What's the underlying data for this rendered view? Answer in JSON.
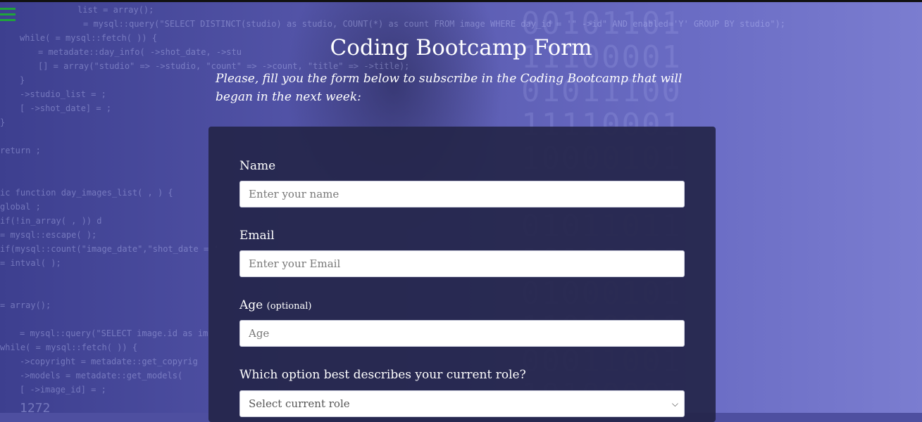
{
  "page": {
    "title": "Coding Bootcamp Form",
    "subtitle": "Please, fill you the form below to subscribe in the Coding Bootcamp that will began in the next week:"
  },
  "menu": {
    "icon": "hamburger-menu-icon"
  },
  "form": {
    "name": {
      "label": "Name",
      "placeholder": "Enter your name"
    },
    "email": {
      "label": "Email",
      "placeholder": "Enter your Email"
    },
    "age": {
      "label": "Age",
      "optional": "(optional)",
      "placeholder": "Age"
    },
    "role": {
      "label": "Which option best describes your current role?",
      "selected": "Select current role",
      "icon": "chevron-down-icon"
    }
  },
  "background": {
    "code_lines": [
      "list = array();",
      "= mysql::query(\"SELECT DISTINCT(studio) as studio, COUNT(*) as count FROM image WHERE day_id = '\" ->id\" AND enabled='Y' GROUP BY studio\");",
      "while(       = mysql::fetch(          )) {",
      "    = metadate::day_info(     ->shot_date,            ->stu",
      "           [] = array(\"studio\" =>            ->studio, \"count\" =>        ->count, \"title\" =>      ->title);",
      "}",
      "->studio_list =              ;",
      "    [    ->shot_date] =     ;",
      "}",
      "return        ;",
      "ic function day_images_list(     ,        ) {",
      "global                    ;",
      "if(!in_array(       ,                 )) d",
      "     = mysql::escape(     );",
      "if(mysql::count(\"image_date\",\"shot_date = '",
      "      = intval(      );",
      "        = array();",
      "       = mysql::query(\"SELECT image.id as im",
      "while(       = mysql::fetch(       )) {",
      "    ->copyright = metadate::get_copyrig",
      "    ->models = metadate::get_models(",
      "         [      ->image_id] =        ;",
      "1272"
    ],
    "binary_rows": [
      "00101101",
      "11100001",
      "01011100",
      "11110001",
      "10000101",
      "00110101",
      "01011011",
      "10101100",
      "01000101",
      "11010011",
      "00011001",
      "10100001"
    ]
  }
}
